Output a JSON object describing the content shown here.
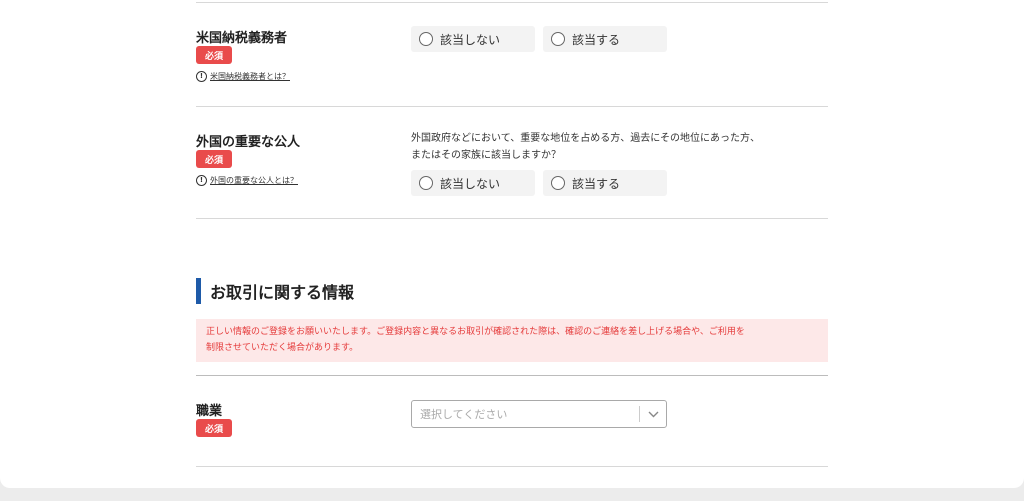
{
  "us_tax": {
    "label": "米国納税義務者",
    "required": "必須",
    "help_icon": "!",
    "help_text": "米国納税義務者とは？",
    "options": [
      "該当しない",
      "該当する"
    ]
  },
  "pep": {
    "label": "外国の重要な公人",
    "required": "必須",
    "help_icon": "!",
    "help_text": "外国の重要な公人とは？",
    "question_line1": "外国政府などにおいて、重要な地位を占める方、過去にその地位にあった方、",
    "question_line2": "またはその家族に該当しますか？",
    "options": [
      "該当しない",
      "該当する"
    ]
  },
  "transaction_section": {
    "title": "お取引に関する情報",
    "notice_line1": "正しい情報のご登録をお願いいたします。ご登録内容と異なるお取引が確認された際は、確認のご連絡を差し上げる場合や、ご利用を",
    "notice_line2": "制限させていただく場合があります。"
  },
  "occupation": {
    "label": "職業",
    "required": "必須",
    "placeholder": "選択してください",
    "icon": "chevron-down-icon"
  },
  "colors": {
    "required_badge": "#e94b4b",
    "section_bar": "#1e5aa8",
    "notice_bg": "#fde8e8",
    "notice_text": "#e53b3b"
  }
}
